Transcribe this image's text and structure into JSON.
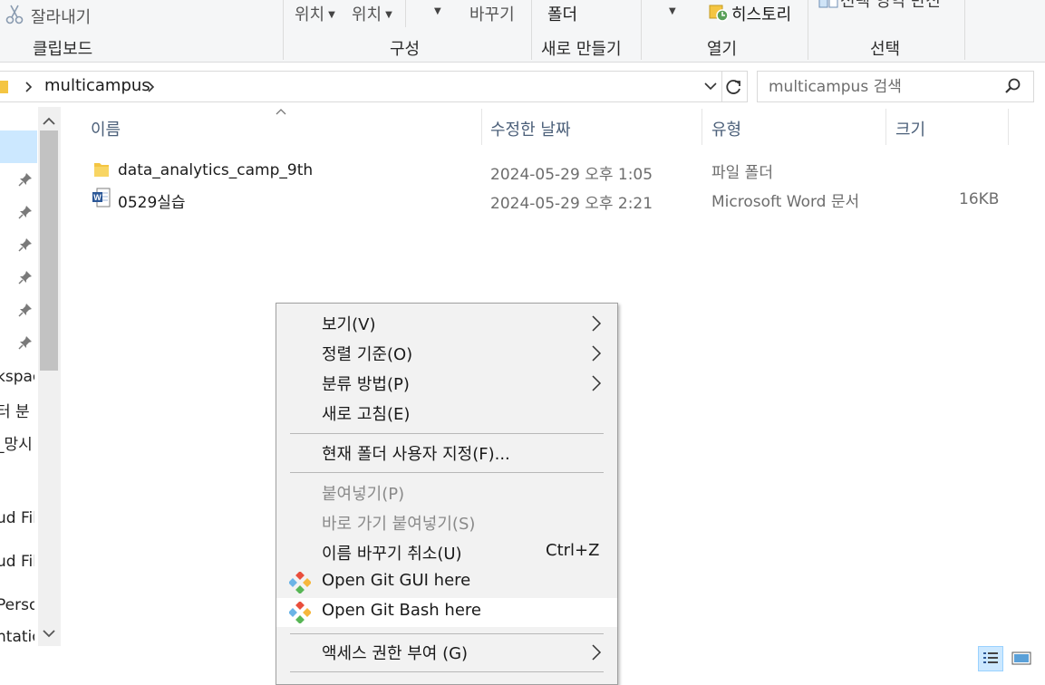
{
  "ribbon": {
    "cut_label": "잘라내기",
    "group_clipboard": "클립보드",
    "location1": "위치",
    "location2": "위치",
    "rename": "바꾸기",
    "group_organize": "구성",
    "folder": "폴더",
    "group_new": "새로 만들기",
    "history": "히스토리",
    "group_open": "열기",
    "invert_select": "선택 영역 반전",
    "group_select": "선택"
  },
  "address": {
    "path": [
      "multicampus"
    ],
    "search_placeholder": "multicampus 검색"
  },
  "nav": {
    "items": [
      "kspac",
      "터 분",
      "_망시",
      "ud File",
      "ud File",
      "Person",
      "ntatio"
    ]
  },
  "columns": {
    "name": "이름",
    "modified": "수정한 날짜",
    "type": "유형",
    "size": "크기"
  },
  "files": [
    {
      "name": "data_analytics_camp_9th",
      "modified": "2024-05-29 오후 1:05",
      "type": "파일 폴더",
      "size": ""
    },
    {
      "name": "0529실습",
      "modified": "2024-05-29 오후 2:21",
      "type": "Microsoft Word 문서",
      "size": "16KB"
    }
  ],
  "context_menu": {
    "view": "보기(V)",
    "sort": "정렬 기준(O)",
    "group": "분류 방법(P)",
    "refresh": "새로 고침(E)",
    "customize": "현재 폴더 사용자 지정(F)...",
    "paste": "붙여넣기(P)",
    "paste_shortcut": "바로 가기 붙여넣기(S)",
    "undo_rename": "이름 바꾸기 취소(U)",
    "undo_shortcut": "Ctrl+Z",
    "git_gui": "Open Git GUI here",
    "git_bash": "Open Git Bash here",
    "access": "액세스 권한 부여 (G)"
  },
  "colors": {
    "selection": "#cce8ff",
    "folder": "#f4c542",
    "word": "#2b5797",
    "header_text": "#4c607a"
  }
}
